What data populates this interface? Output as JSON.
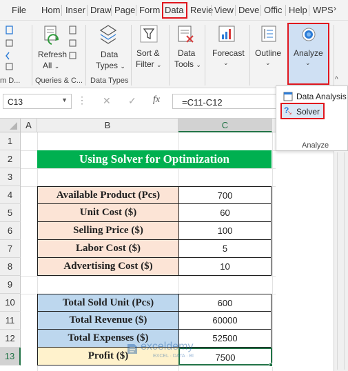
{
  "tabs": [
    "File",
    "Hom",
    "Inser",
    "Draw",
    "Page",
    "Form",
    "Data",
    "Revie",
    "View",
    "Deve",
    "Offic",
    "Help",
    "WPS"
  ],
  "ribbon": {
    "left_group_label": "m D...",
    "queries_label": "Queries & C...",
    "data_types_group_label": "Data Types",
    "refresh_label": "Refresh",
    "refresh_all_label": "All",
    "data_types_btn_1": "Data",
    "data_types_btn_2": "Types",
    "sort_filter_1": "Sort &",
    "sort_filter_2": "Filter",
    "data_tools_1": "Data",
    "data_tools_2": "Tools",
    "forecast_label": "Forecast",
    "outline_label": "Outline",
    "analyze_label": "Analyze"
  },
  "formula_bar": {
    "name_box": "C13",
    "fx_symbol": "fx",
    "formula": "=C11-C12"
  },
  "dropdown": {
    "data_analysis": "Data Analysis",
    "solver": "Solver",
    "group_label": "Analyze"
  },
  "columns": [
    "A",
    "B",
    "C"
  ],
  "rows": [
    "1",
    "2",
    "3",
    "4",
    "5",
    "6",
    "7",
    "8",
    "9",
    "10",
    "11",
    "12",
    "13"
  ],
  "sheet": {
    "title": "Using Solver for Optimization",
    "inputs": [
      {
        "label": "Available Product (Pcs)",
        "value": "700"
      },
      {
        "label": "Unit Cost ($)",
        "value": "60"
      },
      {
        "label": "Selling Price ($)",
        "value": "100"
      },
      {
        "label": "Labor Cost ($)",
        "value": "5"
      },
      {
        "label": "Advertising Cost ($)",
        "value": "10"
      }
    ],
    "outputs": [
      {
        "label": "Total Sold Unit (Pcs)",
        "value": "600"
      },
      {
        "label": "Total Revenue ($)",
        "value": "60000"
      },
      {
        "label": "Total Expenses ($)",
        "value": "52500"
      }
    ],
    "profit": {
      "label": "Profit ($)",
      "value": "7500"
    }
  },
  "watermark": {
    "name": "exceldemy",
    "tagline": "EXCEL · DATA · BI"
  },
  "colors": {
    "title_green": "#00b050",
    "input_peach": "#fce4d6",
    "output_blue": "#bdd7ee",
    "profit_yellow": "#fff2cc",
    "highlight_red": "#e0161e"
  }
}
